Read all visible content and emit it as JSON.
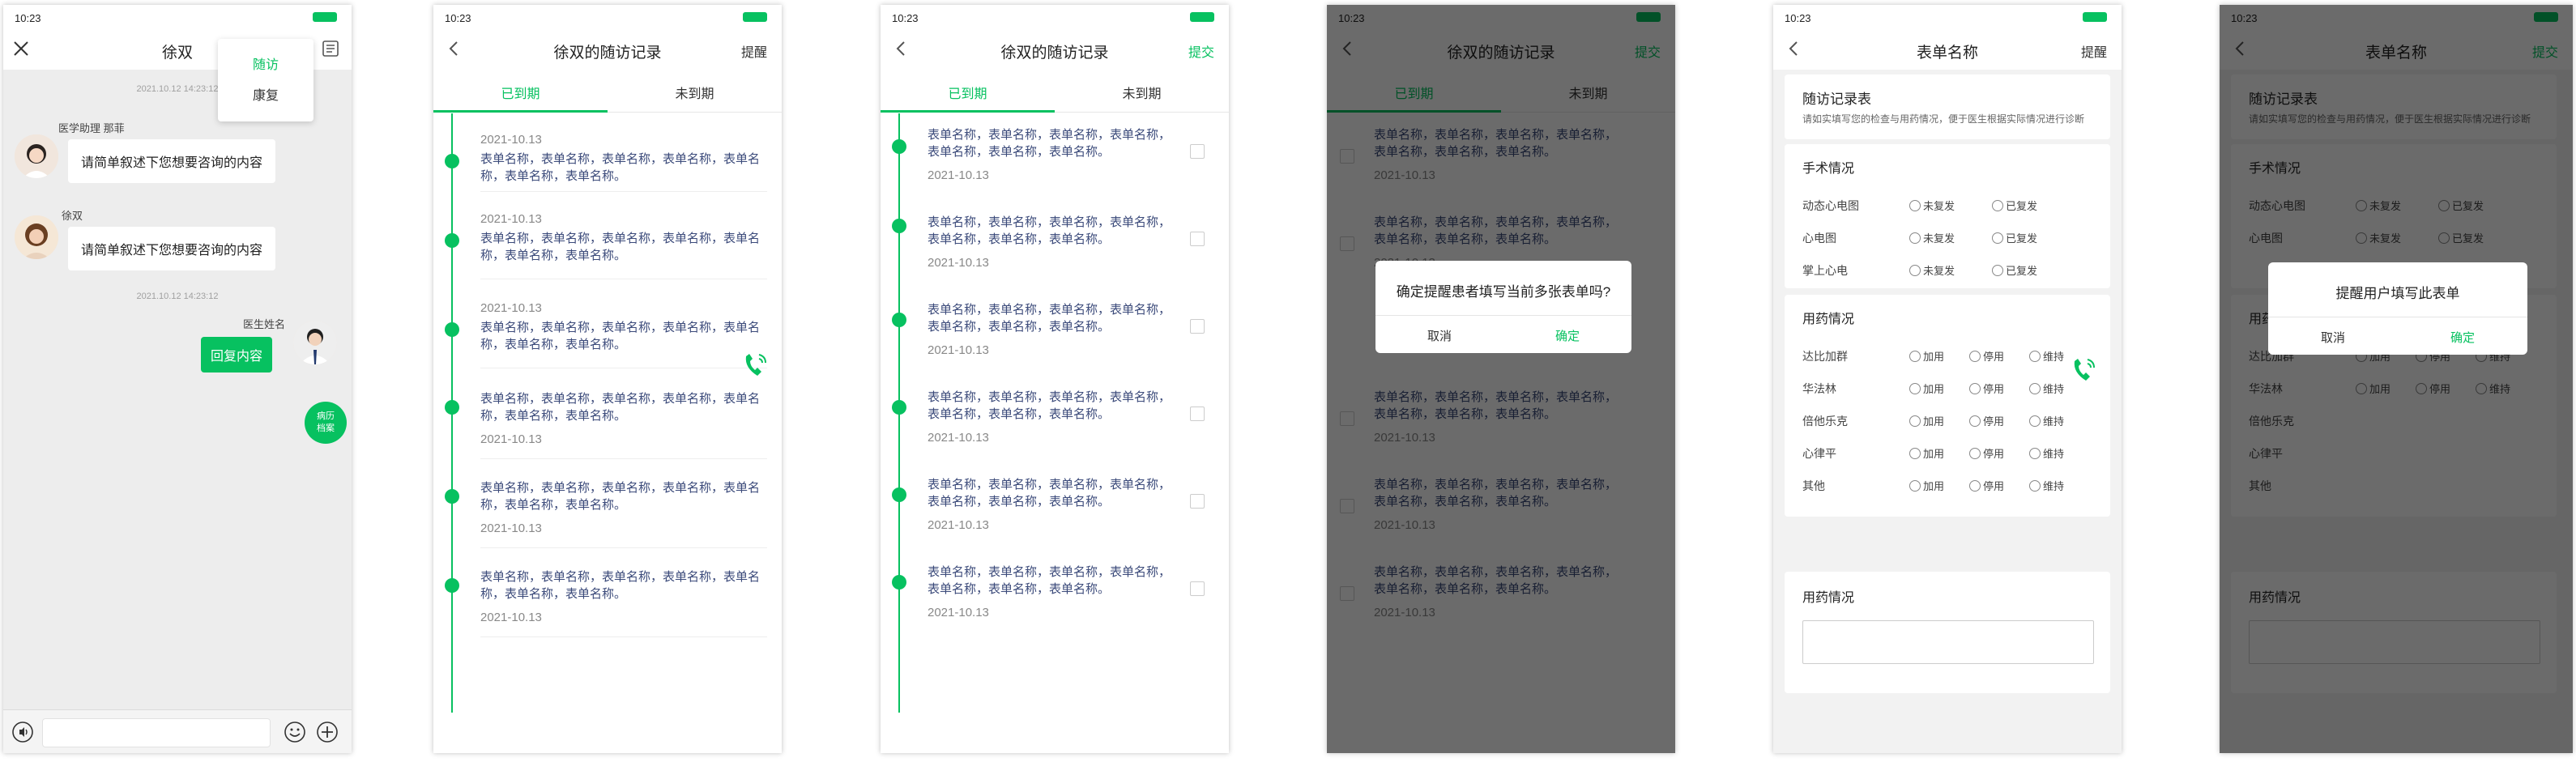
{
  "status": {
    "time": "10:23"
  },
  "chat": {
    "title": "徐双",
    "menu": [
      "随访",
      "康复"
    ],
    "timestamp1": "2021.10.12 14:23:12",
    "timestamp2": "2021.10.12 14:23:12",
    "assistant_name": "医学助理 那菲",
    "assistant_msg": "请简单叙述下您想要咨询的内容",
    "patient_name": "徐双",
    "patient_msg": "请简单叙述下您想要咨询的内容",
    "doctor_name": "医生姓名",
    "doctor_msg": "回复内容",
    "badge_line1": "病历",
    "badge_line2": "档案"
  },
  "records": {
    "title": "徐双的随访记录",
    "remind": "提醒",
    "submit": "提交",
    "tab_due": "已到期",
    "tab_not_due": "未到期",
    "date": "2021-10.13",
    "names": "表单名称，表单名称，表单名称，表单名称，表单名称，表单名称，表单名称。",
    "names_short": "表单名称，表单名称，表单名称，表单名称，表单名称，表单名称，表单名称。"
  },
  "dialog1": {
    "message": "确定提醒患者填写当前多张表单吗?",
    "cancel": "取消",
    "confirm": "确定"
  },
  "form": {
    "title": "表单名称",
    "remind": "提醒",
    "submit": "提交",
    "card_title": "随访记录表",
    "card_desc": "请如实填写您的检查与用药情况，便于医生根据实际情况进行诊断",
    "surgery": {
      "heading": "手术情况",
      "rows": [
        "动态心电图",
        "心电图",
        "掌上心电"
      ],
      "options": [
        "未复发",
        "已复发"
      ]
    },
    "medication": {
      "heading": "用药情况",
      "rows": [
        "达比加群",
        "华法林",
        "倍他乐克",
        "心律平",
        "其他"
      ],
      "options": [
        "加用",
        "停用",
        "维持"
      ]
    },
    "medication2": {
      "heading": "用药情况"
    }
  },
  "dialog2": {
    "message": "提醒用户填写此表单",
    "cancel": "取消",
    "confirm": "确定"
  },
  "colors": {
    "accent": "#07c160",
    "link_text": "#3b4a7a"
  }
}
